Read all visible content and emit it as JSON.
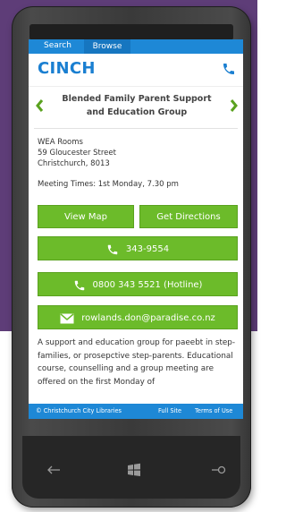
{
  "tabs": {
    "search": "Search",
    "browse": "Browse"
  },
  "header": {
    "brand": "CINCH"
  },
  "listing": {
    "title_line1": "Blended Family Parent Support",
    "title_line2": "and Education Group",
    "address_line1": "WEA Rooms",
    "address_line2": "59 Gloucester Street",
    "address_line3": "Christchurch, 8013",
    "meeting_times": "Meeting Times: 1st Monday, 7.30 pm",
    "view_map": "View Map",
    "get_directions": "Get Directions",
    "phone": "343-9554",
    "hotline": "0800 343 5521 (Hotline)",
    "email": "rowlands.don@paradise.co.nz",
    "description": "A support and education group for paeebt in step-families, or prosepctive step-parents. Educational course, counselling and a group meeting are offered on the first Monday of"
  },
  "footer": {
    "copyright": "© Christchurch City Libraries",
    "full_site": "Full Site",
    "terms": "Terms of Use"
  },
  "colors": {
    "accent_blue": "#1e88d6",
    "button_green": "#6cbb2a",
    "background_purple": "#5e3d78"
  },
  "icons": [
    "phone-icon",
    "chevron-left-icon",
    "chevron-right-icon",
    "envelope-icon",
    "back-arrow-icon",
    "windows-icon",
    "search-icon"
  ]
}
